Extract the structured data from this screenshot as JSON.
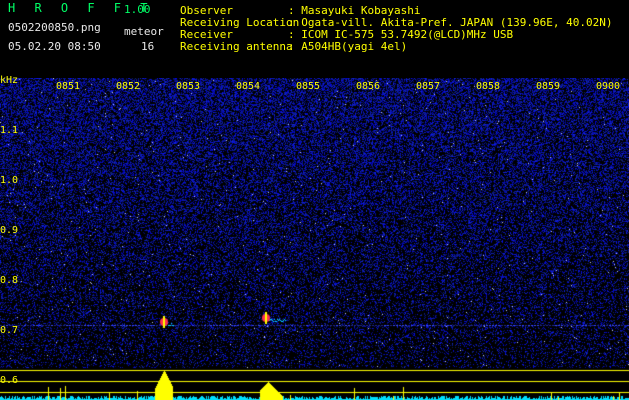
{
  "header": {
    "app_title": "H R O F F T",
    "app_version": "1.00",
    "file_name": "0502200850.png",
    "meteor_label": "meteor",
    "date_time": "05.02.20 08:50",
    "meteor_count": "16"
  },
  "metadata": {
    "rows": [
      {
        "label": "Observer",
        "value": ": Masayuki Kobayashi"
      },
      {
        "label": "Receiving Location",
        "value": ": Ogata-vill. Akita-Pref. JAPAN (139.96E, 40.02N)"
      },
      {
        "label": "Receiver",
        "value": ": ICOM IC-575 53.7492(@LCD)MHz USB"
      },
      {
        "label": "Receiving antenna",
        "value": ": A504HB(yagi 4el)"
      }
    ]
  },
  "spectrogram": {
    "y_unit": "kHz",
    "y_ticks": [
      "1.1",
      "1.0",
      "0.9",
      "0.8",
      "0.7",
      "0.6"
    ],
    "x_ticks": [
      "0851",
      "0852",
      "0853",
      "0854",
      "0855",
      "0856",
      "0857",
      "0858",
      "0859",
      "0900"
    ],
    "colors": {
      "background": "#000000",
      "noise": "#1a22a0",
      "text": "#ffff00",
      "signal": "#ff3050",
      "spectrum": "#ffff00",
      "baseline": "#00e0ff"
    }
  }
}
